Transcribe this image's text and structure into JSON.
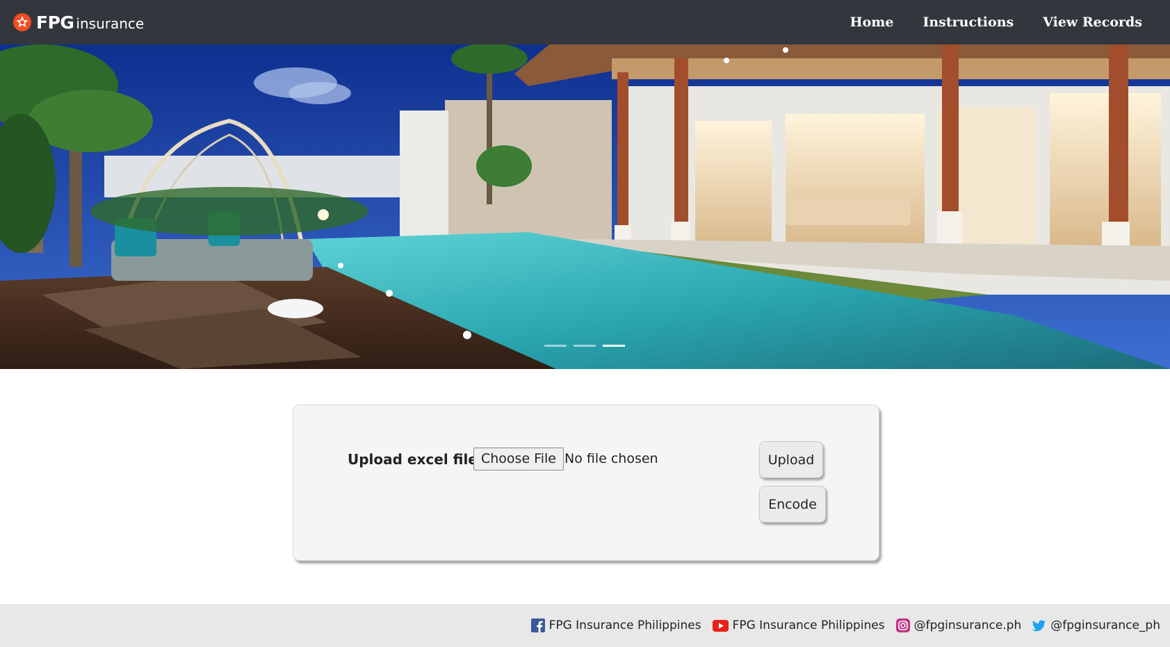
{
  "header": {
    "logo_brand": "FPG",
    "logo_sub": "insurance",
    "nav": [
      {
        "label": "Home"
      },
      {
        "label": "Instructions"
      },
      {
        "label": "View Records"
      }
    ]
  },
  "hero": {
    "slides_shown": 3,
    "active_slide": 3
  },
  "upload": {
    "label": "Upload excel file",
    "choose_label": "Choose File",
    "file_status": "No file chosen",
    "upload_button": "Upload",
    "encode_button": "Encode"
  },
  "footer": {
    "links": [
      {
        "icon": "facebook-icon",
        "label": "FPG Insurance Philippines",
        "color": "#3b5998"
      },
      {
        "icon": "youtube-icon",
        "label": "FPG Insurance Philippines",
        "color": "#e62117"
      },
      {
        "icon": "instagram-icon",
        "label": "@fpginsurance.ph",
        "color": "#c13584"
      },
      {
        "icon": "twitter-icon",
        "label": "@fpginsurance_ph",
        "color": "#1da1f2"
      }
    ]
  },
  "colors": {
    "navbar_bg": "#33373d",
    "brand_orange": "#f04e23",
    "footer_bg": "#e8e8e8",
    "card_bg": "#f5f5f5"
  }
}
